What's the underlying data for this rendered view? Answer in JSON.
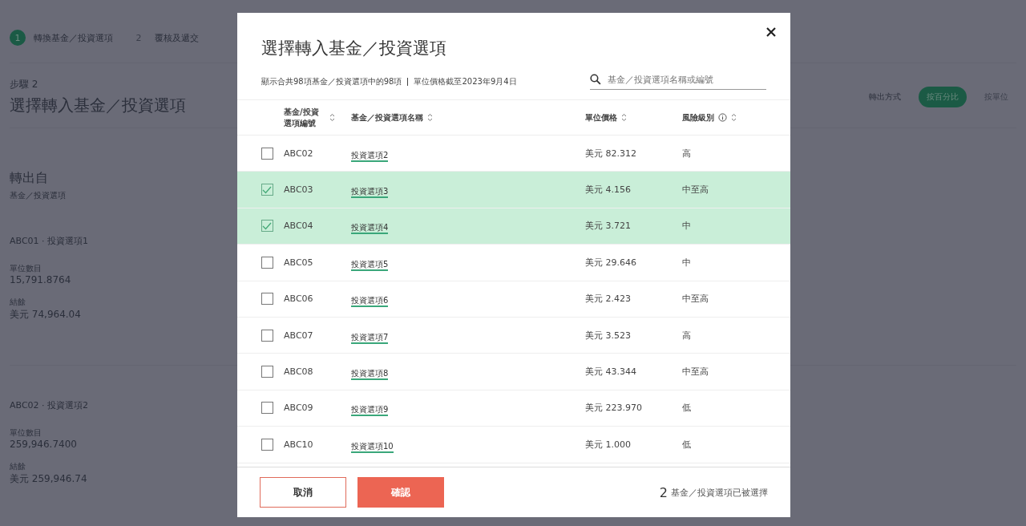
{
  "steps": [
    {
      "number": "1",
      "label": "轉換基金／投資選項",
      "selected": true
    },
    {
      "number": "2",
      "label": "覆核及遞交",
      "selected": false
    }
  ],
  "page": {
    "step_label": "步驟 2",
    "title": "選擇轉入基金／投資選項"
  },
  "transfer_method": {
    "label": "轉出方式",
    "options": [
      {
        "label": "按百分比",
        "selected": true
      },
      {
        "label": "按單位",
        "selected": false
      }
    ]
  },
  "source": {
    "title": "轉出自",
    "subtitle": "基金／投資選項",
    "holdings": [
      {
        "name": "ABC01 · 投資選項1",
        "units_label": "單位數目",
        "units": "15,791.8764",
        "balance_label": "結餘",
        "balance": "美元 74,964.04"
      },
      {
        "name": "ABC02 · 投資選項2",
        "units_label": "單位數目",
        "units": "259,946.7400",
        "balance_label": "結餘",
        "balance": "美元 259,946.74"
      }
    ]
  },
  "modal": {
    "title": "選擇轉入基金／投資選項",
    "info": "顯示合共98項基金／投資選項中的98項",
    "date_note": "單位價格截至2023年9月4日",
    "search": {
      "placeholder": "基金／投資選項名稱或編號"
    },
    "columns": [
      {
        "label": "基金/投資選項編號"
      },
      {
        "label": "基金／投資選項名稱"
      },
      {
        "label": "單位價格"
      },
      {
        "label": "風險級別"
      }
    ],
    "rows": [
      {
        "code": "ABC02",
        "name": "投資選項2",
        "price": "美元 82.312",
        "risk": "高",
        "selected": false
      },
      {
        "code": "ABC03",
        "name": "投資選項3",
        "price": "美元 4.156",
        "risk": "中至高",
        "selected": true
      },
      {
        "code": "ABC04",
        "name": "投資選項4",
        "price": "美元 3.721",
        "risk": "中",
        "selected": true
      },
      {
        "code": "ABC05",
        "name": "投資選項5",
        "price": "美元 29.646",
        "risk": "中",
        "selected": false
      },
      {
        "code": "ABC06",
        "name": "投資選項6",
        "price": "美元 2.423",
        "risk": "中至高",
        "selected": false
      },
      {
        "code": "ABC07",
        "name": "投資選項7",
        "price": "美元 3.523",
        "risk": "高",
        "selected": false
      },
      {
        "code": "ABC08",
        "name": "投資選項8",
        "price": "美元 43.344",
        "risk": "中至高",
        "selected": false
      },
      {
        "code": "ABC09",
        "name": "投資選項9",
        "price": "美元 223.970",
        "risk": "低",
        "selected": false
      },
      {
        "code": "ABC10",
        "name": "投資選項10",
        "price": "美元 1.000",
        "risk": "低",
        "selected": false
      }
    ],
    "cancel": "取消",
    "confirm": "確認",
    "selected_count": "2",
    "selected_text": "基金／投資選項已被選擇"
  }
}
